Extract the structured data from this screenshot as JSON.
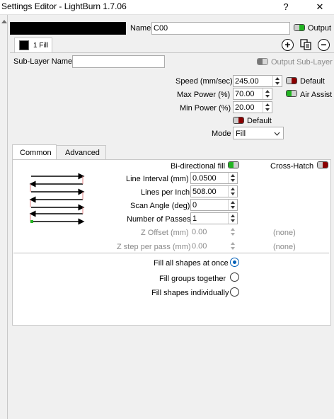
{
  "window": {
    "title": "Settings Editor - LightBurn 1.7.06",
    "help_label": "?",
    "close_label": "✕"
  },
  "layer": {
    "color": "#000000",
    "name_label": "Name",
    "name_value": "C00",
    "output_label": "Output",
    "sublayer_tab_label": "1 Fill",
    "sublayer_name_label": "Sub-Layer Name",
    "sublayer_name_value": "",
    "output_sublayer_label": "Output Sub-Layer"
  },
  "power": {
    "speed_label": "Speed (mm/sec)",
    "speed_value": "245.00",
    "default_label": "Default",
    "max_power_label": "Max Power (%)",
    "max_power_value": "70.00",
    "air_assist_label": "Air Assist",
    "min_power_label": "Min Power (%)",
    "min_power_value": "20.00",
    "default2_label": "Default",
    "mode_label": "Mode",
    "mode_value": "Fill"
  },
  "tabs": {
    "common": "Common",
    "advanced": "Advanced"
  },
  "fill": {
    "bidirectional_label": "Bi-directional fill",
    "crosshatch_label": "Cross-Hatch",
    "line_interval_label": "Line Interval (mm)",
    "line_interval_value": "0.0500",
    "lpi_label": "Lines per Inch",
    "lpi_value": "508.00",
    "scan_angle_label": "Scan Angle (deg)",
    "scan_angle_value": "0",
    "passes_label": "Number of Passes",
    "passes_value": "1",
    "z_offset_label": "Z Offset (mm)",
    "z_offset_value": "0.00",
    "z_offset_note": "(none)",
    "z_step_label": "Z step per pass (mm)",
    "z_step_value": "0.00",
    "z_step_note": "(none)"
  },
  "fill_options": {
    "all_at_once": "Fill all shapes at once",
    "groups_together": "Fill groups together",
    "individually": "Fill shapes individually"
  },
  "colors": {
    "toggle_on": "#22b422",
    "toggle_off": "#8b0000",
    "accent": "#005fb8"
  }
}
